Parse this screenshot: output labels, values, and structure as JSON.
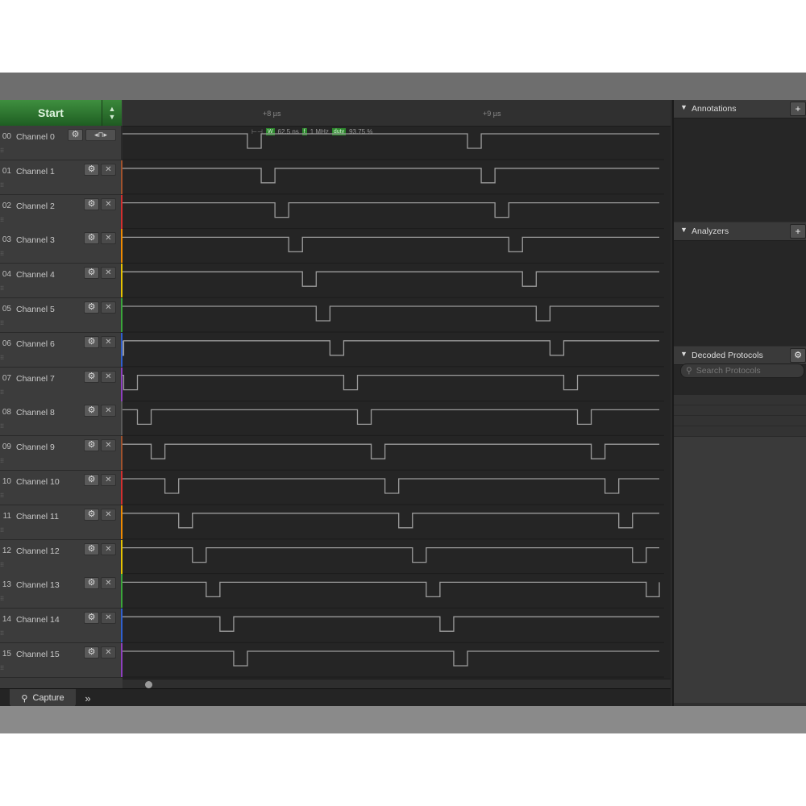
{
  "toolbar": {
    "start_label": "Start",
    "arrows": "▲▼"
  },
  "channels": [
    {
      "num": "00",
      "name": "Channel 0",
      "color": "#2a2a2a"
    },
    {
      "num": "01",
      "name": "Channel 1",
      "color": "#a0522d"
    },
    {
      "num": "02",
      "name": "Channel 2",
      "color": "#d32f2f"
    },
    {
      "num": "03",
      "name": "Channel 3",
      "color": "#ef8a00"
    },
    {
      "num": "04",
      "name": "Channel 4",
      "color": "#e6c200"
    },
    {
      "num": "05",
      "name": "Channel 5",
      "color": "#3aa63a"
    },
    {
      "num": "06",
      "name": "Channel 6",
      "color": "#2f5fd0"
    },
    {
      "num": "07",
      "name": "Channel 7",
      "color": "#8e3fbf"
    },
    {
      "num": "08",
      "name": "Channel 8",
      "color": "#5a5a5a"
    },
    {
      "num": "09",
      "name": "Channel 9",
      "color": "#a0522d"
    },
    {
      "num": "10",
      "name": "Channel 10",
      "color": "#d32f2f"
    },
    {
      "num": "11",
      "name": "Channel 11",
      "color": "#ef8a00"
    },
    {
      "num": "12",
      "name": "Channel 12",
      "color": "#e6c200"
    },
    {
      "num": "13",
      "name": "Channel 13",
      "color": "#3aa63a"
    },
    {
      "num": "14",
      "name": "Channel 14",
      "color": "#2f5fd0"
    },
    {
      "num": "15",
      "name": "Channel 15",
      "color": "#8e3fbf"
    }
  ],
  "icons": {
    "gear": "gear-icon",
    "close": "close-icon",
    "trigger": "trigger-icon",
    "search": "search-icon",
    "add": "plus-icon"
  },
  "ruler": {
    "tick1": "+8 µs",
    "tick2": "+9 µs"
  },
  "measurement": {
    "w_label": "W",
    "width": "62.5 ns",
    "f_label": "f",
    "freq": "1 MHz",
    "duty_label": "duty",
    "duty": "93.75 %"
  },
  "pulse_train": {
    "period_us": 1.0,
    "pulse_width_ns": 62.5,
    "channel_offset_ns": 62.5,
    "duty_percent": 93.75
  },
  "right_panel": {
    "annotations_title": "Annotations",
    "analyzers_title": "Analyzers",
    "decoded_title": "Decoded Protocols",
    "search_placeholder": "Search Protocols"
  },
  "bottom": {
    "capture_tab": "Capture",
    "more": "»"
  }
}
